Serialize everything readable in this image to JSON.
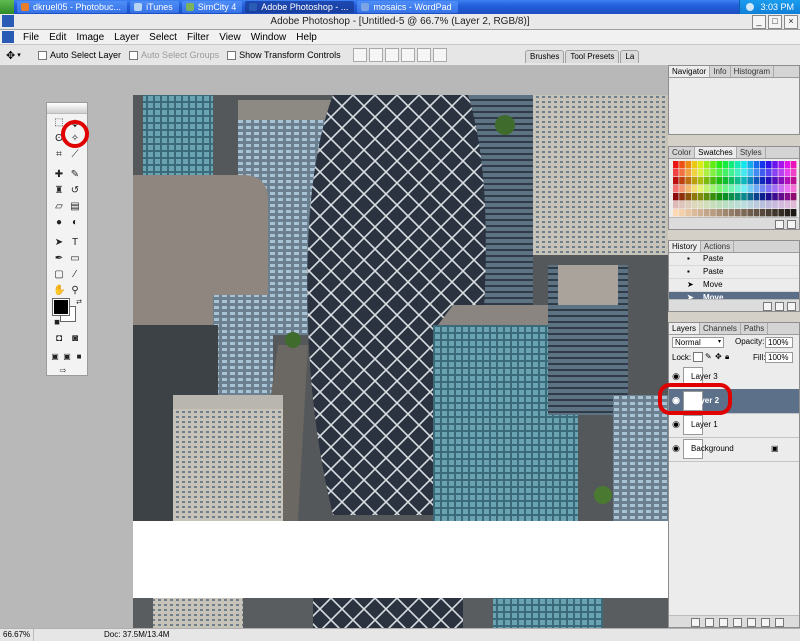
{
  "taskbar": {
    "tasks": [
      {
        "label": "dkruel05 - Photobuc...",
        "color": "#e87e2c"
      },
      {
        "label": "iTunes",
        "color": "#b8d4f4"
      },
      {
        "label": "SimCity 4",
        "color": "#7db35a"
      },
      {
        "label": "Adobe Photoshop - ...",
        "color": "#2a5bb5"
      },
      {
        "label": "mosaics - WordPad",
        "color": "#7aa4e6"
      }
    ],
    "clock": "3:03 PM"
  },
  "window": {
    "title": "Adobe Photoshop - [Untitled-5 @ 66.7% (Layer 2, RGB/8)]",
    "controls": [
      "_",
      "□",
      "×"
    ]
  },
  "menu": [
    "File",
    "Edit",
    "Image",
    "Layer",
    "Select",
    "Filter",
    "View",
    "Window",
    "Help"
  ],
  "options_bar": {
    "auto_select_layer": "Auto Select Layer",
    "auto_select_groups": "Auto Select Groups",
    "show_transform_controls": "Show Transform Controls",
    "palette_well_tabs": [
      "Brushes",
      "Tool Presets",
      "La"
    ]
  },
  "panels": {
    "navigator_tabs": [
      "Navigator",
      "Info",
      "Histogram"
    ],
    "swatches_tabs": [
      "Color",
      "Swatches",
      "Styles"
    ],
    "history_tabs": [
      "History",
      "Actions"
    ],
    "history_items": [
      "Paste",
      "Paste",
      "Move",
      "Move"
    ],
    "layers_tabs": [
      "Layers",
      "Channels",
      "Paths"
    ],
    "blend_mode": "Normal",
    "opacity_label": "Opacity:",
    "opacity": "100%",
    "lock_label": "Lock:",
    "fill_label": "Fill:",
    "fill": "100%",
    "layers": [
      {
        "name": "Layer 3",
        "selected": false
      },
      {
        "name": "Layer 2",
        "selected": true
      },
      {
        "name": "Layer 1",
        "selected": false
      },
      {
        "name": "Background",
        "selected": false
      }
    ]
  },
  "status": {
    "zoom": "66.67%",
    "doc": "Doc: 37.5M/13.4M"
  },
  "colors": {
    "highlight": "#e00000",
    "selection": "#5d7089",
    "taskbar": "#245edb"
  },
  "icons": [
    "move-tool-icon",
    "eye-icon",
    "lock-icon",
    "trash-icon",
    "new-layer-icon"
  ]
}
